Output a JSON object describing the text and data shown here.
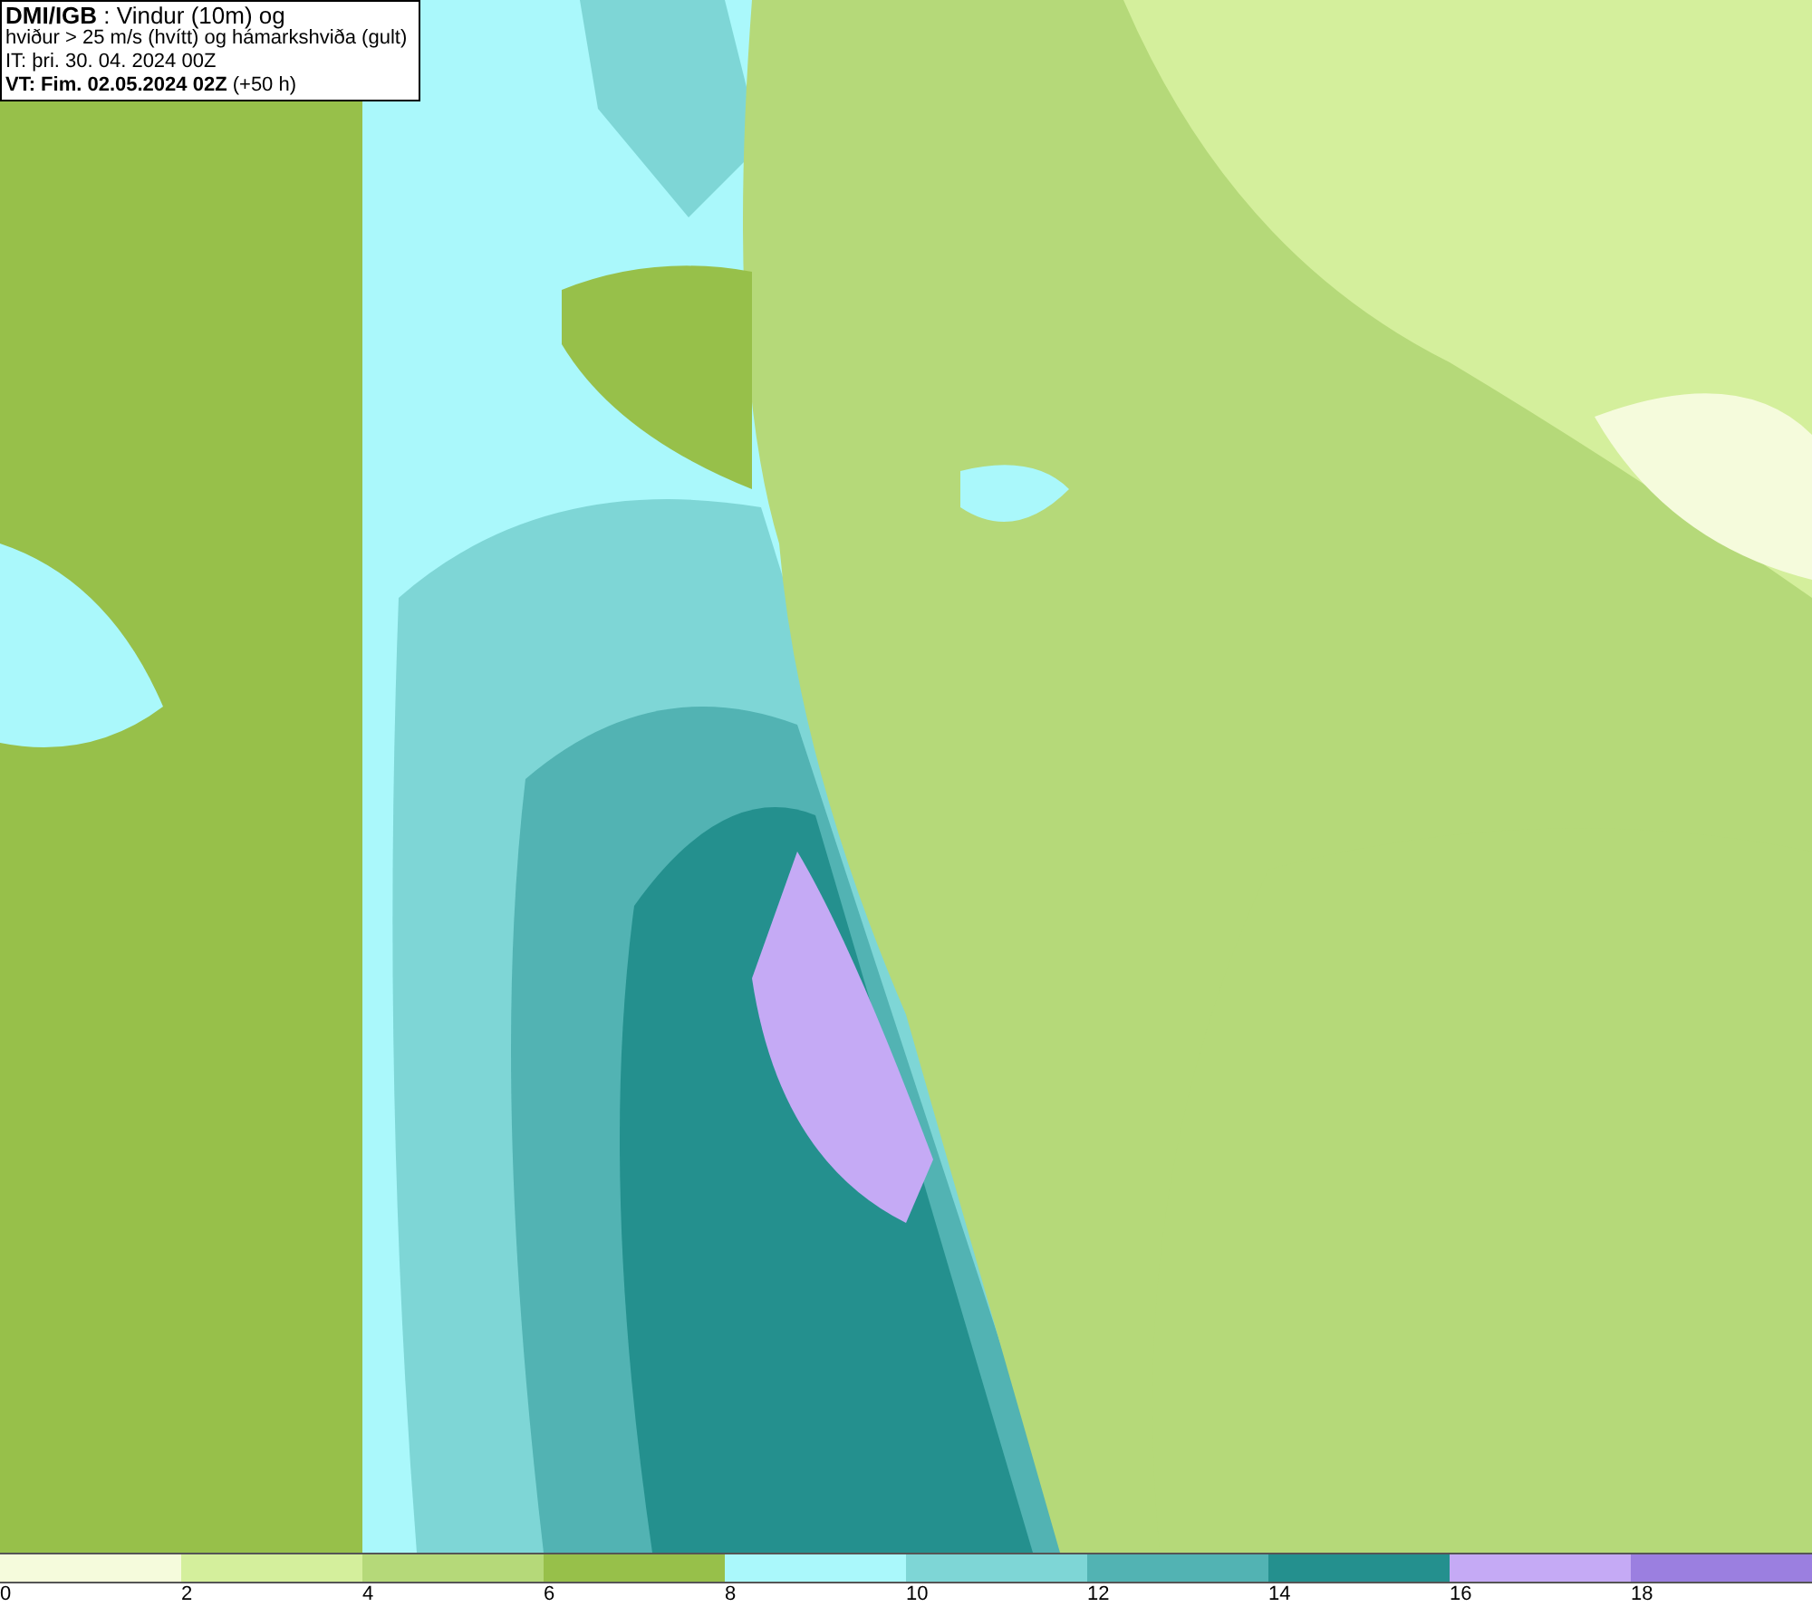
{
  "header": {
    "lines": [
      "**DMI/IGB** : Vindur (10m) og",
      "hviður > 25 m/s (hvítt) og hámarkshviða (gult)",
      "IT: þri. 30. 04. 2024 00Z",
      "**VT: Fim. 02.05.2024 02Z** (+50 h)"
    ]
  },
  "legend": [
    {
      "label": "0",
      "color": "#f5fbdc"
    },
    {
      "label": "2",
      "color": "#d4ef9c"
    },
    {
      "label": "4",
      "color": "#b5d979"
    },
    {
      "label": "6",
      "color": "#97c04a"
    },
    {
      "label": "8",
      "color": "#aaf8fb"
    },
    {
      "label": "10",
      "color": "#7ed6d6"
    },
    {
      "label": "12",
      "color": "#52b3b3"
    },
    {
      "label": "14",
      "color": "#24908e"
    },
    {
      "label": "16",
      "color": "#c5aaf5"
    },
    {
      "label": "18",
      "color": "#9b7fe0"
    }
  ]
}
